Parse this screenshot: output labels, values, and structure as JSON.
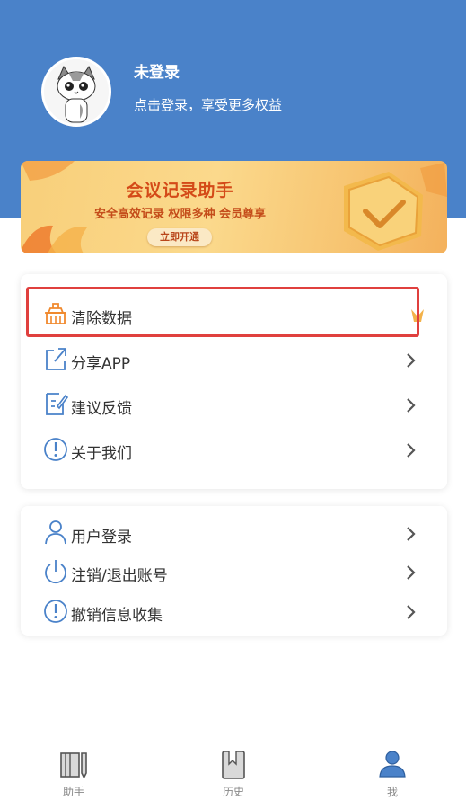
{
  "profile": {
    "name": "未登录",
    "subtitle": "点击登录，享受更多权益"
  },
  "banner": {
    "title": "会议记录助手",
    "subtitle": "安全高效记录 权限多种 会员尊享",
    "button": "立即开通"
  },
  "menu1": [
    {
      "label": "清除数据",
      "icon": "broom-icon"
    },
    {
      "label": "分享APP",
      "icon": "share-icon"
    },
    {
      "label": "建议反馈",
      "icon": "feedback-icon"
    },
    {
      "label": "关于我们",
      "icon": "info-icon"
    }
  ],
  "menu2": [
    {
      "label": "用户登录",
      "icon": "user-icon"
    },
    {
      "label": "注销/退出账号",
      "icon": "power-icon"
    },
    {
      "label": "撤销信息收集",
      "icon": "info-icon"
    }
  ],
  "tabs": [
    {
      "label": "助手",
      "icon": "notebook-icon"
    },
    {
      "label": "历史",
      "icon": "bookmark-book-icon"
    },
    {
      "label": "我",
      "icon": "person-icon"
    }
  ],
  "colors": {
    "header": "#4a82c9",
    "icon_blue": "#4a82c9",
    "highlight_red": "#e0403e",
    "banner_text": "#d44a18"
  }
}
